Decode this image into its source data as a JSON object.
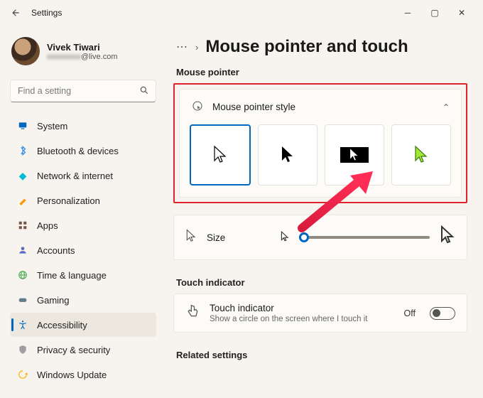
{
  "window": {
    "app_title": "Settings"
  },
  "user": {
    "name": "Vivek Tiwari",
    "email_suffix": "@live.com"
  },
  "search": {
    "placeholder": "Find a setting"
  },
  "nav": [
    {
      "label": "System",
      "icon": "monitor",
      "color": "#1e88e5"
    },
    {
      "label": "Bluetooth & devices",
      "icon": "bt",
      "color": "#1e88e5"
    },
    {
      "label": "Network & internet",
      "icon": "wifi",
      "color": "#00bcd4"
    },
    {
      "label": "Personalization",
      "icon": "brush",
      "color": "#ff9800"
    },
    {
      "label": "Apps",
      "icon": "grid",
      "color": "#795548"
    },
    {
      "label": "Accounts",
      "icon": "person",
      "color": "#5c6bc0"
    },
    {
      "label": "Time & language",
      "icon": "globe",
      "color": "#4caf50"
    },
    {
      "label": "Gaming",
      "icon": "gamepad",
      "color": "#607d8b"
    },
    {
      "label": "Accessibility",
      "icon": "accessibility",
      "color": "#0067c0",
      "active": true
    },
    {
      "label": "Privacy & security",
      "icon": "shield",
      "color": "#9e9e9e"
    },
    {
      "label": "Windows Update",
      "icon": "update",
      "color": "#ffb300"
    }
  ],
  "breadcrumb": {
    "ellipsis": "⋯",
    "title": "Mouse pointer and touch"
  },
  "sections": {
    "mouse_pointer": "Mouse pointer",
    "style_card_title": "Mouse pointer style",
    "size_label": "Size",
    "touch_indicator_section": "Touch indicator",
    "touch_card_title": "Touch indicator",
    "touch_card_desc": "Show a circle on the screen where I touch it",
    "touch_state": "Off",
    "related": "Related settings"
  },
  "cursor_styles": [
    {
      "id": "white",
      "selected": true
    },
    {
      "id": "black",
      "selected": false
    },
    {
      "id": "inverted",
      "selected": false
    },
    {
      "id": "custom",
      "selected": false
    }
  ]
}
